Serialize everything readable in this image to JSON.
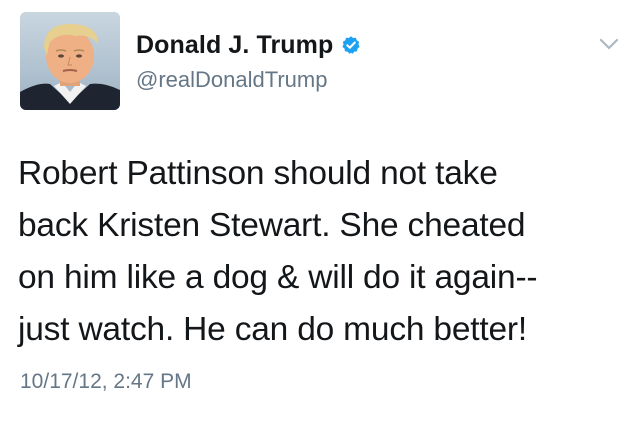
{
  "author": {
    "display_name": "Donald J. Trump",
    "handle": "@realDonaldTrump",
    "verified": true
  },
  "tweet": {
    "text": "Robert Pattinson should not take\nback Kristen Stewart. She cheated\non him like a dog & will do it again--\njust watch. He can do much better!",
    "timestamp": "10/17/12, 2:47 PM"
  },
  "icons": {
    "verified": "verified-badge-icon",
    "more": "chevron-down-icon"
  },
  "colors": {
    "text": "#14171a",
    "secondary": "#657786",
    "verified_blue": "#1da1f2"
  }
}
